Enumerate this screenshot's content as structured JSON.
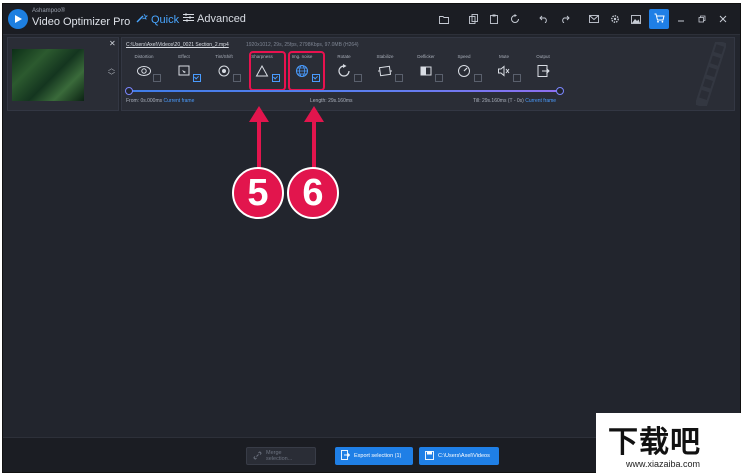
{
  "app": {
    "brand_small": "Ashampoo®",
    "brand_name": "Video Optimizer Pro",
    "modes": [
      {
        "label": "Quick",
        "active": true,
        "icon": "magic-wand-icon"
      },
      {
        "label": "Advanced",
        "active": false,
        "icon": "sliders-icon"
      }
    ],
    "accent": "#1f7fe6"
  },
  "toolbar_icons": [
    "open-folder-icon",
    "copy-icon",
    "paste-icon",
    "reset-icon",
    "undo-icon",
    "redo-icon",
    "mail-icon",
    "settings-icon",
    "image-icon",
    "cart-icon",
    "minimize-icon",
    "restore-icon",
    "close-icon"
  ],
  "video": {
    "path": "C:\\Users\\Axel\\Videos\\20_0021 Section_2.mp4",
    "meta": "1920x1012, 29s, 25fps, 2798Kbps, 97.0MB (H264)",
    "from_label": "From: 0s.000ms",
    "from_link": "Current frame",
    "length_label": "Length: 29s.160ms",
    "till_label": "Till: 29s.160ms (T - 0s)",
    "till_link": "Current frame"
  },
  "tools": [
    {
      "label": "Distortion",
      "icon": "eye-icon",
      "checked": false
    },
    {
      "label": "Effect",
      "icon": "effect-icon",
      "checked": true
    },
    {
      "label": "Tint/Shift",
      "icon": "tint-icon",
      "checked": false
    },
    {
      "label": "Sharpness",
      "icon": "triangle-icon",
      "checked": true
    },
    {
      "label": "Img. noise",
      "icon": "globe-icon",
      "checked": true
    },
    {
      "label": "Rotate",
      "icon": "rotate-icon",
      "checked": false
    },
    {
      "label": "Stabilize",
      "icon": "stabilize-icon",
      "checked": false
    },
    {
      "label": "Deflicker",
      "icon": "deflicker-icon",
      "checked": false
    },
    {
      "label": "Speed",
      "icon": "speedometer-icon",
      "checked": false
    },
    {
      "label": "Mute",
      "icon": "speaker-mute-icon",
      "checked": false
    },
    {
      "label": "Output",
      "icon": "output-icon",
      "checked": false
    }
  ],
  "callouts": [
    {
      "number": "5",
      "color": "#e2154d"
    },
    {
      "number": "6",
      "color": "#e2154d"
    }
  ],
  "bottom": {
    "merge_label": "Merge selection...",
    "export_label": "Export selection (1)",
    "folder_label": "C:\\Users\\Axel\\Videos"
  },
  "watermark": {
    "big": "下载吧",
    "small": "www.xiazaiba.com"
  }
}
